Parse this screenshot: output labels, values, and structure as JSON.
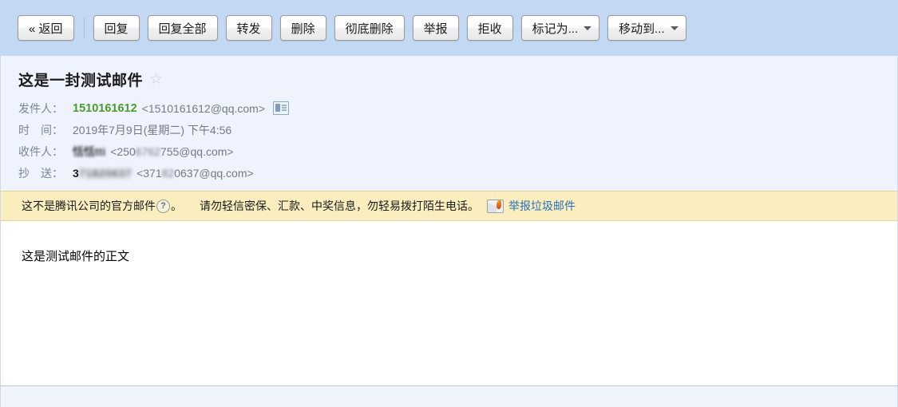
{
  "toolbar": {
    "back_button": "« 返回",
    "buttons": [
      {
        "label": "回复",
        "caret": false
      },
      {
        "label": "回复全部",
        "caret": false
      },
      {
        "label": "转发",
        "caret": false
      },
      {
        "label": "删除",
        "caret": false
      },
      {
        "label": "彻底删除",
        "caret": false
      },
      {
        "label": "举报",
        "caret": false
      },
      {
        "label": "拒收",
        "caret": false
      },
      {
        "label": "标记为...",
        "caret": true
      },
      {
        "label": "移动到...",
        "caret": true
      }
    ]
  },
  "mail": {
    "subject": "这是一封测试邮件",
    "star_glyph": "☆",
    "sender": {
      "label": "发件人：",
      "name": "1510161612",
      "address": "<1510161612@qq.com>"
    },
    "time": {
      "label": "时　间：",
      "value": "2019年7月9日(星期二) 下午4:56"
    },
    "recipient": {
      "label": "收件人：",
      "name": "恬恬tti",
      "address_visible_prefix": "<250",
      "address_blurred": "6762",
      "address_suffix": "755@qq.com>"
    },
    "cc": {
      "label": "抄　送：",
      "name_visible_prefix": "3",
      "name_blurred": "71820637",
      "address_prefix": "<371",
      "address_blurred": "82",
      "address_suffix": "0637@qq.com>"
    },
    "body": "这是测试邮件的正文"
  },
  "warning": {
    "text_before_icon": "这不是腾讯公司的官方邮件",
    "help_glyph": "?",
    "text_after_icon": "。",
    "advice": "请勿轻信密保、汇款、中奖信息，勿轻易拨打陌生电话。",
    "report_link": "举报垃圾邮件"
  },
  "colors": {
    "toolbar_bg": "#c3d8f2",
    "header_bg": "#eff3fd",
    "warning_bg": "#faeebe",
    "sender_green": "#4a9c28",
    "link_blue": "#2a6fbb"
  }
}
